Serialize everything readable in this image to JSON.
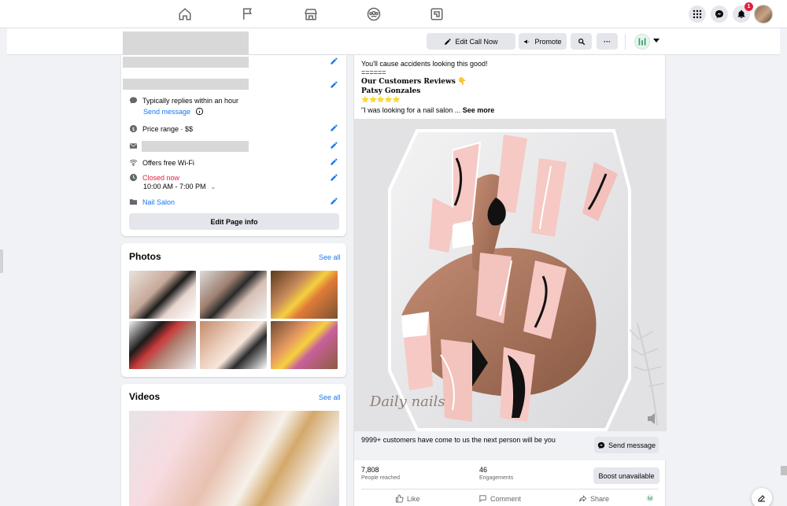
{
  "nav": {
    "icons": [
      "home-icon",
      "flag-icon",
      "marketplace-icon",
      "groups-icon",
      "gaming-icon"
    ],
    "notification_count": "1"
  },
  "actions": {
    "edit_call_now": "Edit Call Now",
    "promote": "Promote",
    "more": "···"
  },
  "intro": {
    "typically_replies": "Typically replies within an hour",
    "send_message": "Send message",
    "price_range": "Price range · $$",
    "wifi": "Offers free Wi-Fi",
    "closed_now": "Closed now",
    "hours": "10:00 AM - 7:00 PM",
    "category": "Nail Salon",
    "edit_page_info": "Edit Page info"
  },
  "photos": {
    "title": "Photos",
    "see_all": "See all"
  },
  "videos": {
    "title": "Videos",
    "see_all": "See all"
  },
  "post": {
    "line1": "You'll cause accidents looking this good!",
    "line2": "======",
    "line3": "Our Customers Reviews 👇",
    "line4": "Patsy Gonzales",
    "stars": "⭐⭐⭐⭐⭐",
    "excerpt": "\"I was looking for a nail salon ... ",
    "see_more": "See more",
    "watermark": "Daily nails",
    "cta_text": "9999+ customers have come to us the next person will be you",
    "send_message": "Send message",
    "reached_value": "7,808",
    "reached_label": "People reached",
    "engagements_value": "46",
    "engagements_label": "Engagements",
    "boost": "Boost unavailable",
    "like": "Like",
    "comment": "Comment",
    "share": "Share"
  },
  "colors": {
    "link": "#1877f2",
    "closed": "#e41e3f",
    "accent_bg": "#e4e6eb",
    "page_bg": "#f0f2f5"
  }
}
